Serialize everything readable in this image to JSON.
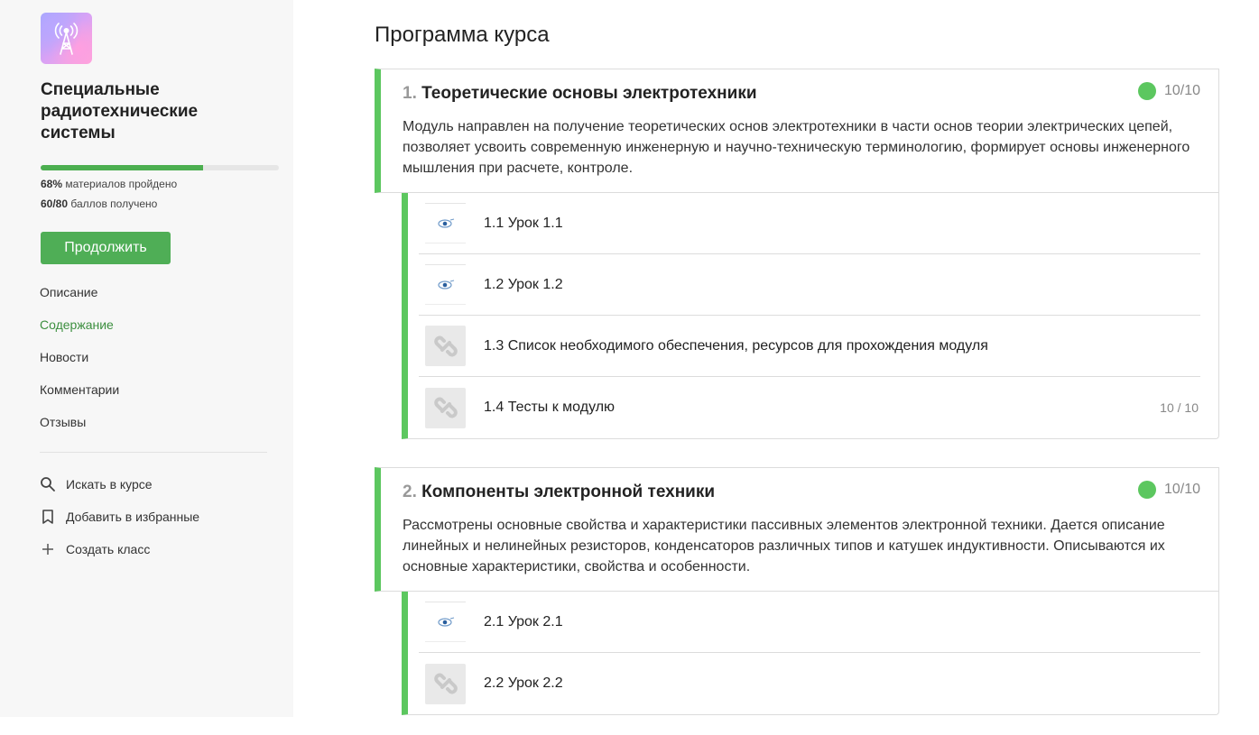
{
  "sidebar": {
    "course_title": "Специальные радиотехнические системы",
    "progress_fraction": 0.68,
    "materials_pct": "68%",
    "materials_text": " материалов пройдено",
    "points": "60/80",
    "points_text": " баллов получено",
    "continue_label": "Продолжить",
    "nav": [
      {
        "label": "Описание"
      },
      {
        "label": "Содержание",
        "active": true
      },
      {
        "label": "Новости"
      },
      {
        "label": "Комментарии"
      },
      {
        "label": "Отзывы"
      }
    ],
    "actions": [
      {
        "label": "Искать в курсе",
        "icon": "search-icon"
      },
      {
        "label": "Добавить в избранные",
        "icon": "bookmark-icon"
      },
      {
        "label": "Создать класс",
        "icon": "plus-icon"
      }
    ]
  },
  "main": {
    "title": "Программа курса",
    "modules": [
      {
        "num": "1.",
        "title": "Теоретические основы электротехники",
        "score": "10/10",
        "description": "Модуль направлен на получение теоретических основ электротехники в части основ теории электрических цепей, позволяет усвоить современную инженерную и научно-техническую терминологию, формирует основы инженерного мышления при расчете, контроле.",
        "lessons": [
          {
            "title": "1.1 Урок 1.1",
            "thumb": "image",
            "score": ""
          },
          {
            "title": "1.2 Урок 1.2",
            "thumb": "image",
            "score": ""
          },
          {
            "title": "1.3 Список необходимого обеспечения, ресурсов для прохождения модуля",
            "thumb": "link",
            "score": ""
          },
          {
            "title": "1.4 Тесты к модулю",
            "thumb": "link",
            "score": "10 / 10"
          }
        ]
      },
      {
        "num": "2.",
        "title": "Компоненты электронной техники",
        "score": "10/10",
        "description": "Рассмотрены основные свойства и характеристики пассивных элементов электронной техники. Дается описание линейных и нелинейных резисторов, конденсаторов различных типов и катушек индуктивности. Описываются их основные характеристики, свойства и особенности.",
        "lessons": [
          {
            "title": "2.1 Урок 2.1",
            "thumb": "image",
            "score": ""
          },
          {
            "title": "2.2 Урок 2.2",
            "thumb": "link",
            "score": ""
          }
        ]
      }
    ]
  },
  "colors": {
    "accent": "#4fae56",
    "module_bar": "#5cc75f",
    "active_nav": "#3c8f3f"
  }
}
